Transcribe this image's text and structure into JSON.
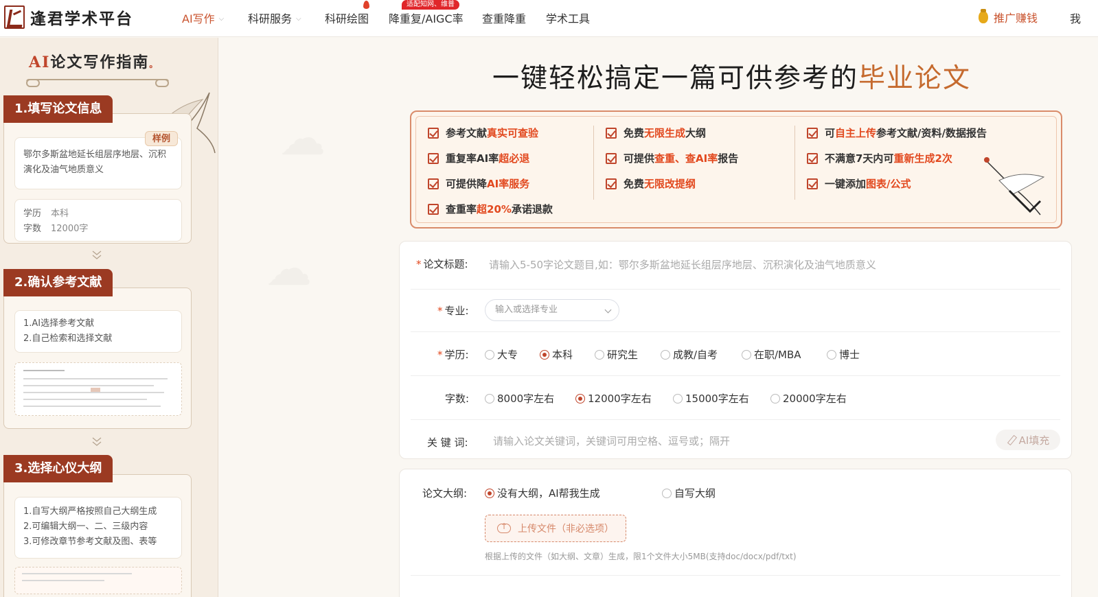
{
  "brand": {
    "name": "逢君学术平台"
  },
  "nav": {
    "items": [
      {
        "label": "AI写作",
        "has_caret": true,
        "active": true
      },
      {
        "label": "科研服务",
        "has_caret": true
      },
      {
        "label": "科研绘图"
      },
      {
        "label": "降重复/AIGC率",
        "badge": "适配知网、维普"
      },
      {
        "label": "查重降重"
      },
      {
        "label": "学术工具"
      }
    ],
    "promote": "推广赚钱",
    "cut_text": "我"
  },
  "guide": {
    "title_ai": "AI",
    "title_rest": "论文写作指南",
    "title_dot": "。",
    "steps": [
      {
        "tag": "1.填写论文信息",
        "sample_badge": "样例",
        "sample_text": "鄂尔多斯盆地延长组层序地层、沉积演化及油气地质意义",
        "degree_key": "学历",
        "degree_val": "本科",
        "words_key": "字数",
        "words_val": "12000字"
      },
      {
        "tag": "2.确认参考文献",
        "lines": [
          "1.AI选择参考文献",
          "2.自己检索和选择文献"
        ]
      },
      {
        "tag": "3.选择心仪大纲",
        "lines": [
          "1.自写大纲严格按照自己大纲生成",
          "2.可编辑大纲一、二、三级内容",
          "3.可修改章节参考文献及图、表等"
        ]
      }
    ]
  },
  "headline": {
    "part1": "一键轻松搞定一篇可供参考的",
    "part2": "毕业论文"
  },
  "benefits": [
    {
      "pre": "参考文献",
      "hl": "真实可查验",
      "post": ""
    },
    {
      "pre": "免费",
      "hl": "无限生成",
      "post": "大纲"
    },
    {
      "pre": "可",
      "hl": "自主上传",
      "post": "参考文献/资料/数据报告"
    },
    {
      "pre": "重复率AI率",
      "hl": "超必退",
      "post": ""
    },
    {
      "pre": "可提供",
      "hl": "查重、查AI率",
      "post": "报告"
    },
    {
      "pre": "不满意7天内可",
      "hl": "重新生成2次",
      "post": ""
    },
    {
      "pre": "可提供降",
      "hl": "AI率服务",
      "post": ""
    },
    {
      "pre": "免费",
      "hl": "无限改提纲",
      "post": ""
    },
    {
      "pre": "一键添加",
      "hl": "图表/公式",
      "post": ""
    },
    {
      "pre": "查重率",
      "hl": "超20%",
      "post": "承诺退款"
    }
  ],
  "form": {
    "title_label": "论文标题:",
    "title_placeholder": "请输入5-50字论文题目,如：鄂尔多斯盆地延长组层序地层、沉积演化及油气地质意义",
    "major_label": "专业:",
    "major_placeholder": "输入或选择专业",
    "degree_label": "学历:",
    "degree_options": [
      "大专",
      "本科",
      "研究生",
      "成教/自考",
      "在职/MBA",
      "博士"
    ],
    "degree_selected": "本科",
    "words_label": "字数:",
    "words_options": [
      "8000字左右",
      "12000字左右",
      "15000字左右",
      "20000字左右"
    ],
    "words_selected": "12000字左右",
    "keywords_label": "关 键 词:",
    "keywords_placeholder": "请输入论文关键词，关键词可用空格、逗号或；隔开",
    "ai_fill": "AI填充",
    "outline_label": "论文大纲:",
    "outline_options": [
      "没有大纲，AI帮我生成",
      "自写大纲"
    ],
    "outline_selected": "没有大纲，AI帮我生成",
    "upload_label": "上传文件（非必选项）",
    "upload_hint": "根据上传的文件（如大纲、文章）生成，限1个文件大小5MB(支持doc/docx/pdf/txt)"
  },
  "colors": {
    "accent": "#c0452b",
    "highlight": "#e2491f",
    "tag_bg": "#9b3a22"
  }
}
